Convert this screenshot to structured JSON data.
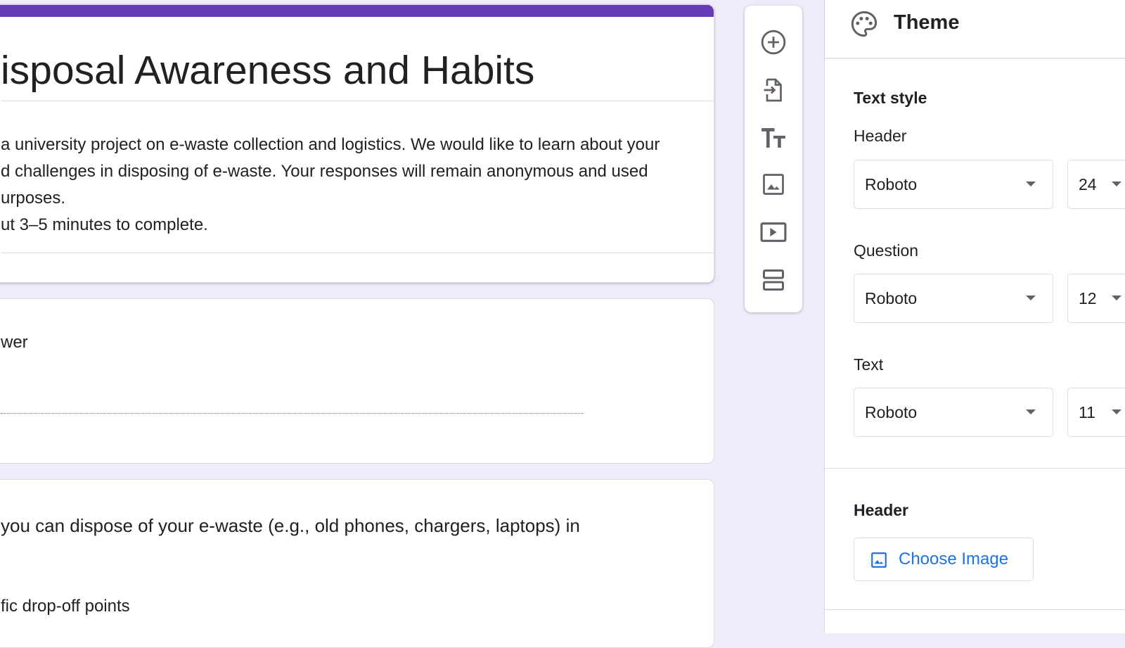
{
  "colors": {
    "accent": "#673ab7",
    "background": "#efebf8",
    "link": "#1a73e8"
  },
  "form": {
    "title": "isposal Awareness and Habits",
    "description_lines": [
      "a university project on e-waste collection and logistics. We would like to learn about your",
      "d challenges in disposing of e-waste. Your responses will remain anonymous and used",
      "urposes.",
      "ut 3–5 minutes to complete."
    ],
    "questions": [
      {
        "text": "wer"
      },
      {
        "text": "you can dispose of your e-waste (e.g., old phones, chargers, laptops) in",
        "option": "fic drop-off points"
      }
    ]
  },
  "toolbar": {
    "icons": [
      "add-question-icon",
      "import-questions-icon",
      "add-title-icon",
      "add-image-icon",
      "add-video-icon",
      "add-section-icon"
    ]
  },
  "theme_panel": {
    "title": "Theme",
    "text_style_label": "Text style",
    "fields": [
      {
        "label": "Header",
        "font": "Roboto",
        "size": "24"
      },
      {
        "label": "Question",
        "font": "Roboto",
        "size": "12"
      },
      {
        "label": "Text",
        "font": "Roboto",
        "size": "11"
      }
    ],
    "header_section_label": "Header",
    "choose_image_label": "Choose Image"
  }
}
